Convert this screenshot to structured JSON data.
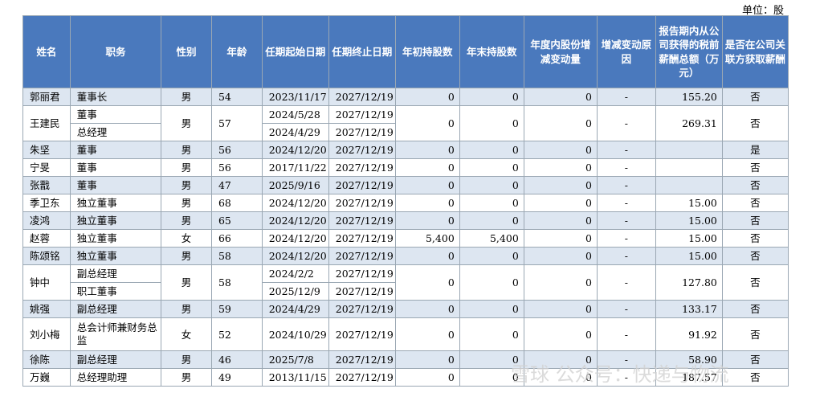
{
  "unit_label": "单位：股",
  "headers": [
    "姓名",
    "职务",
    "性别",
    "年龄",
    "任期起始日期",
    "任期终止日期",
    "年初持股数",
    "年末持股数",
    "年度内股份增减变动量",
    "增减变动原因",
    "报告期内从公司获得的税前薪酬总额（万元）",
    "是否在公司关联方获取薪酬"
  ],
  "rows": [
    {
      "name": "郭丽君",
      "titles": [
        "董事长"
      ],
      "gender": "男",
      "age": "54",
      "starts": [
        "2023/11/17"
      ],
      "ends": [
        "2027/12/19"
      ],
      "begin_shares": "0",
      "end_shares": "0",
      "change": "0",
      "reason": "-",
      "pay": "155.20",
      "related": "否"
    },
    {
      "name": "王建民",
      "titles": [
        "董事",
        "总经理"
      ],
      "gender": "男",
      "age": "57",
      "starts": [
        "2024/5/28",
        "2024/4/29"
      ],
      "ends": [
        "2027/12/19",
        "2027/12/19"
      ],
      "begin_shares": "0",
      "end_shares": "0",
      "change": "0",
      "reason": "-",
      "pay": "269.31",
      "related": "否"
    },
    {
      "name": "朱坚",
      "titles": [
        "董事"
      ],
      "gender": "男",
      "age": "56",
      "starts": [
        "2024/12/20"
      ],
      "ends": [
        "2027/12/19"
      ],
      "begin_shares": "0",
      "end_shares": "0",
      "change": "0",
      "reason": "-",
      "pay": "",
      "related": "是"
    },
    {
      "name": "宁旻",
      "titles": [
        "董事"
      ],
      "gender": "男",
      "age": "56",
      "starts": [
        "2017/11/22"
      ],
      "ends": [
        "2027/12/19"
      ],
      "begin_shares": "0",
      "end_shares": "0",
      "change": "0",
      "reason": "-",
      "pay": "",
      "related": "否"
    },
    {
      "name": "张戬",
      "titles": [
        "董事"
      ],
      "gender": "男",
      "age": "47",
      "starts": [
        "2025/9/16"
      ],
      "ends": [
        "2027/12/19"
      ],
      "begin_shares": "0",
      "end_shares": "0",
      "change": "0",
      "reason": "-",
      "pay": "",
      "related": "否"
    },
    {
      "name": "季卫东",
      "titles": [
        "独立董事"
      ],
      "gender": "男",
      "age": "68",
      "starts": [
        "2024/12/20"
      ],
      "ends": [
        "2027/12/19"
      ],
      "begin_shares": "0",
      "end_shares": "0",
      "change": "0",
      "reason": "-",
      "pay": "15.00",
      "related": "否"
    },
    {
      "name": "凌鸿",
      "titles": [
        "独立董事"
      ],
      "gender": "男",
      "age": "65",
      "starts": [
        "2024/12/20"
      ],
      "ends": [
        "2027/12/19"
      ],
      "begin_shares": "0",
      "end_shares": "0",
      "change": "0",
      "reason": "-",
      "pay": "15.00",
      "related": "否"
    },
    {
      "name": "赵蓉",
      "titles": [
        "独立董事"
      ],
      "gender": "女",
      "age": "66",
      "starts": [
        "2024/12/20"
      ],
      "ends": [
        "2027/12/19"
      ],
      "begin_shares": "5,400",
      "end_shares": "5,400",
      "change": "0",
      "reason": "-",
      "pay": "15.00",
      "related": "否"
    },
    {
      "name": "陈颂铭",
      "titles": [
        "独立董事"
      ],
      "gender": "男",
      "age": "58",
      "starts": [
        "2024/12/20"
      ],
      "ends": [
        "2027/12/19"
      ],
      "begin_shares": "0",
      "end_shares": "0",
      "change": "0",
      "reason": "-",
      "pay": "15.00",
      "related": "否"
    },
    {
      "name": "钟中",
      "titles": [
        "副总经理",
        "职工董事"
      ],
      "gender": "男",
      "age": "58",
      "starts": [
        "2024/2/2",
        "2025/12/9"
      ],
      "ends": [
        "2027/12/19",
        "2027/12/19"
      ],
      "begin_shares": "0",
      "end_shares": "0",
      "change": "0",
      "reason": "-",
      "pay": "127.80",
      "related": "否"
    },
    {
      "name": "姚强",
      "titles": [
        "副总经理"
      ],
      "gender": "男",
      "age": "59",
      "starts": [
        "2024/4/29"
      ],
      "ends": [
        "2027/12/19"
      ],
      "begin_shares": "0",
      "end_shares": "0",
      "change": "0",
      "reason": "-",
      "pay": "133.17",
      "related": "否"
    },
    {
      "name": "刘小梅",
      "titles": [
        "总会计师兼财务总监"
      ],
      "gender": "女",
      "age": "52",
      "starts": [
        "2024/10/29"
      ],
      "ends": [
        "2027/12/19"
      ],
      "begin_shares": "0",
      "end_shares": "0",
      "change": "0",
      "reason": "-",
      "pay": "91.92",
      "related": "否",
      "wrap_title": true
    },
    {
      "name": "徐陈",
      "titles": [
        "副总经理"
      ],
      "gender": "男",
      "age": "46",
      "starts": [
        "2025/7/8"
      ],
      "ends": [
        "2027/12/19"
      ],
      "begin_shares": "0",
      "end_shares": "0",
      "change": "0",
      "reason": "-",
      "pay": "58.90",
      "related": "否"
    },
    {
      "name": "万巍",
      "titles": [
        "总经理助理"
      ],
      "gender": "男",
      "age": "49",
      "starts": [
        "2013/11/15"
      ],
      "ends": [
        "2027/12/19"
      ],
      "begin_shares": "0",
      "end_shares": "0",
      "change": "0",
      "reason": "-",
      "pay": "187.57",
      "related": "否"
    }
  ],
  "watermark": "雪球 公众号：快递与物流"
}
